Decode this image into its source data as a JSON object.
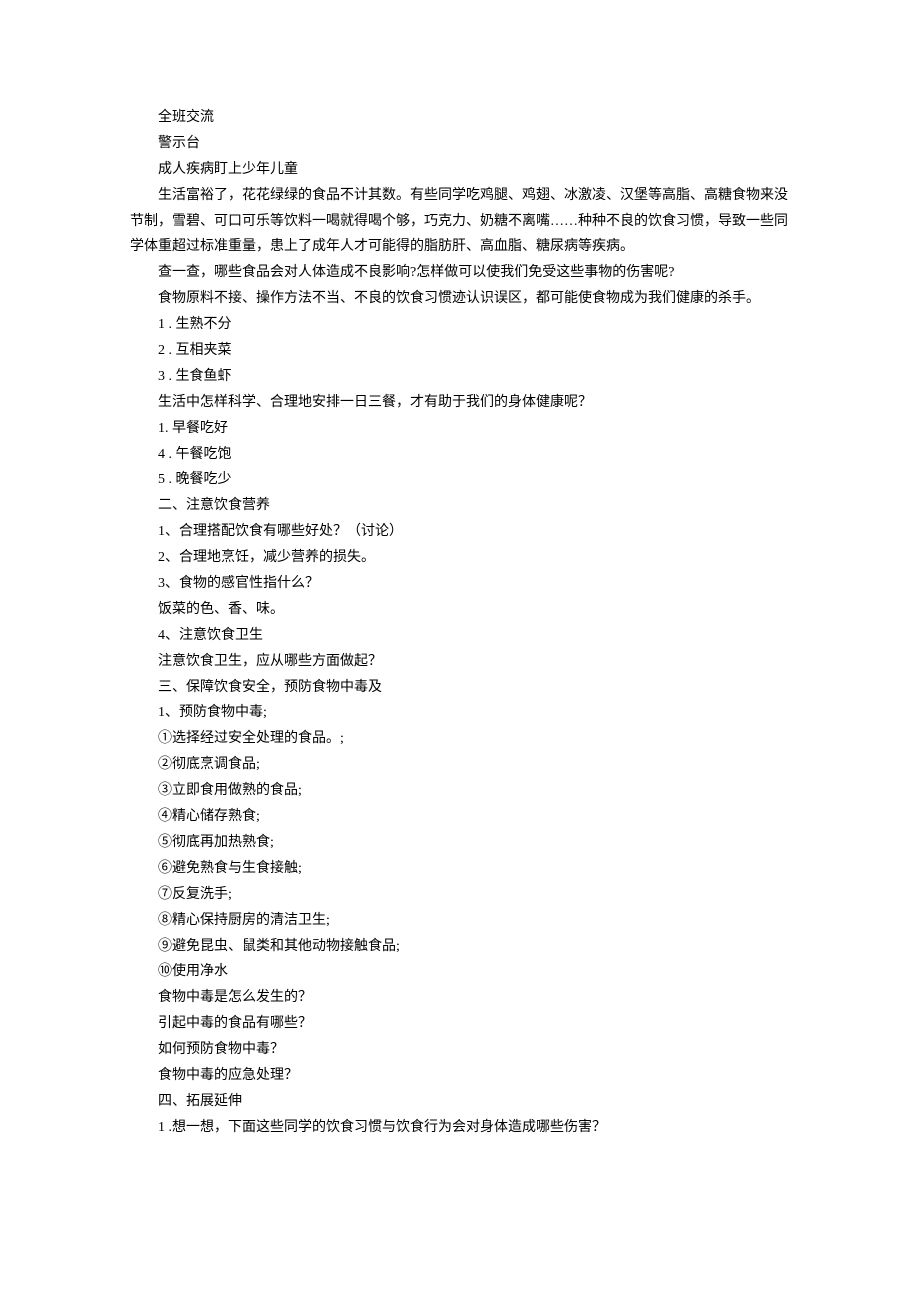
{
  "lines": [
    {
      "text": "全班交流",
      "indent": true
    },
    {
      "text": "警示台",
      "indent": true
    },
    {
      "text": "成人疾病盯上少年儿童",
      "indent": true
    },
    {
      "text": "生活富裕了，花花绿绿的食品不计其数。有些同学吃鸡腿、鸡翅、冰激凌、汉堡等高脂、高糖食物来没节制，雪碧、可口可乐等饮料一喝就得喝个够，巧克力、奶糖不离嘴……种种不良的饮食习惯，导致一些同学体重超过标准重量，患上了成年人才可能得的脂肪肝、高血脂、糖尿病等疾病。",
      "indent": true
    },
    {
      "text": "查一查，哪些食品会对人体造成不良影响?怎样做可以使我们免受这些事物的伤害呢?",
      "indent": true
    },
    {
      "text": "食物原料不接、操作方法不当、不良的饮食习惯迹认识误区，都可能使食物成为我们健康的杀手。",
      "indent": true
    },
    {
      "text": "1  . 生熟不分",
      "indent": true
    },
    {
      "text": "2  . 互相夹菜",
      "indent": true
    },
    {
      "text": "3  . 生食鱼虾",
      "indent": true
    },
    {
      "text": "生活中怎样科学、合理地安排一日三餐，才有助于我们的身体健康呢？",
      "indent": true
    },
    {
      "text": "1.  早餐吃好",
      "indent": true
    },
    {
      "text": "4  . 午餐吃饱",
      "indent": true
    },
    {
      "text": "5  . 晚餐吃少",
      "indent": true
    },
    {
      "text": "二、注意饮食营养",
      "indent": true
    },
    {
      "text": "1、合理搭配饮食有哪些好处？（讨论）",
      "indent": true
    },
    {
      "text": "2、合理地烹饪，减少营养的损失。",
      "indent": true
    },
    {
      "text": "3、食物的感官性指什么？",
      "indent": true
    },
    {
      "text": "饭菜的色、香、味。",
      "indent": true
    },
    {
      "text": "4、注意饮食卫生",
      "indent": true
    },
    {
      "text": "注意饮食卫生，应从哪些方面做起？",
      "indent": true
    },
    {
      "text": "三、保障饮食安全，预防食物中毒及",
      "indent": true
    },
    {
      "text": "1、预防食物中毒;",
      "indent": true
    },
    {
      "text": "①选择经过安全处理的食品。;",
      "indent": true
    },
    {
      "text": "②彻底烹调食品;",
      "indent": true
    },
    {
      "text": "③立即食用做熟的食品;",
      "indent": true
    },
    {
      "text": "④精心储存熟食;",
      "indent": true
    },
    {
      "text": "⑤彻底再加热熟食;",
      "indent": true
    },
    {
      "text": "⑥避免熟食与生食接触;",
      "indent": true
    },
    {
      "text": "⑦反复洗手;",
      "indent": true
    },
    {
      "text": "⑧精心保持厨房的清洁卫生;",
      "indent": true
    },
    {
      "text": "⑨避免昆虫、鼠类和其他动物接触食品;",
      "indent": true
    },
    {
      "text": "⑩使用净水",
      "indent": true
    },
    {
      "text": "食物中毒是怎么发生的？",
      "indent": true
    },
    {
      "text": "引起中毒的食品有哪些？",
      "indent": true
    },
    {
      "text": "如何预防食物中毒？",
      "indent": true
    },
    {
      "text": "食物中毒的应急处理？",
      "indent": true
    },
    {
      "text": "四、拓展延伸",
      "indent": true
    },
    {
      "text": "1  .想一想，下面这些同学的饮食习惯与饮食行为会对身体造成哪些伤害？",
      "indent": true
    }
  ]
}
